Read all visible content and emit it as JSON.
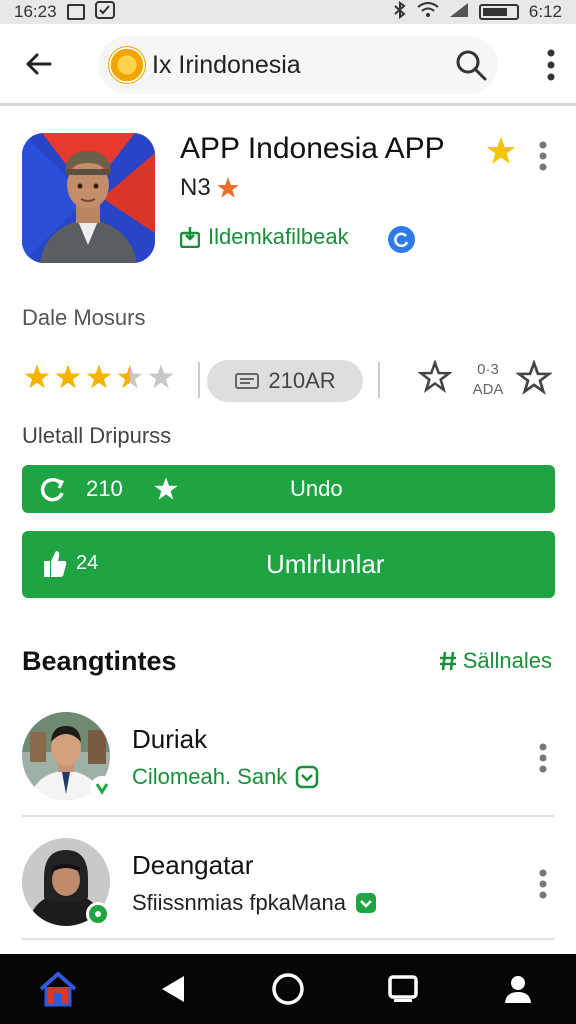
{
  "status_bar": {
    "time": "16:23",
    "clock_right": "6:12"
  },
  "search": {
    "query": "Ix Irindonesia"
  },
  "app": {
    "title": "APP Indonesia APP",
    "subtitle": "N3",
    "developer": "Ildemkafilbeak",
    "meta_label": "Dale Mosurs",
    "rating_stars": 3.5,
    "review_count": "210AR",
    "mini_top": "0·3",
    "mini_bottom": "ADA",
    "detail_label": "Uletall Dripurss"
  },
  "buttons": {
    "primary": {
      "count": "210",
      "label": "Undo"
    },
    "secondary": {
      "count": "24",
      "label": "Umlrlunlar"
    }
  },
  "section": {
    "title": "Beangtintes",
    "link": "Sällnales"
  },
  "list": [
    {
      "name": "Duriak",
      "subtitle": "Cilomeah. Sank",
      "subtitle_color": "#1a8f3a"
    },
    {
      "name": "Deangatar",
      "subtitle": "Sfiissnmias fpkaMana",
      "subtitle_color": "#222222"
    }
  ],
  "colors": {
    "accent_green": "#1ea443",
    "star_gold": "#f5b400",
    "verified_blue": "#2f7be8"
  },
  "icons": [
    "back-arrow-icon",
    "search-icon",
    "more-vert-icon",
    "star-icon",
    "verified-icon",
    "home-icon",
    "back-triangle-icon",
    "circle-home-icon",
    "recents-icon",
    "person-icon"
  ]
}
